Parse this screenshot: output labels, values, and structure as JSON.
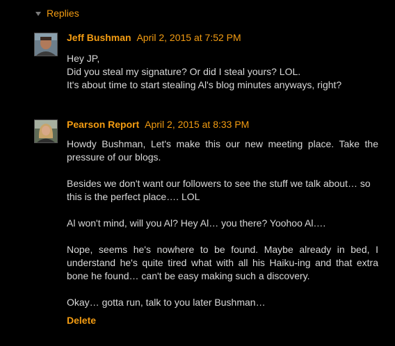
{
  "replies": {
    "toggle_label": "Replies",
    "icon": "caret-down-icon"
  },
  "comments": [
    {
      "author": "Jeff Bushman",
      "timestamp": "April 2, 2015 at 7:52 PM",
      "avatar_icon": "avatar-photo-man",
      "lines": [
        "Hey JP,",
        "Did you steal my signature? Or did I steal yours? LOL.",
        "It's about time to start stealing Al's blog minutes anyways, right?"
      ]
    },
    {
      "author": "Pearson Report",
      "timestamp": "April 2, 2015 at 8:33 PM",
      "avatar_icon": "avatar-photo-woman",
      "paragraphs": [
        "Howdy Bushman, Let's make this our new meeting place. Take the pressure of our blogs.",
        "Besides we don't want our followers to see the stuff we talk about… so this is the perfect place…. LOL",
        "Al won't mind, will you Al? Hey Al… you there? Yoohoo Al….",
        "Nope, seems he's nowhere to be found. Maybe already in bed, I understand he's quite tired what with all his Haiku-ing and that extra bone he found… can't be easy making such a discovery.",
        "Okay… gotta run, talk to you later Bushman…"
      ],
      "delete_label": "Delete"
    }
  ],
  "colors": {
    "background": "#000000",
    "accent": "#f39c12",
    "text": "#d9d9d9"
  }
}
